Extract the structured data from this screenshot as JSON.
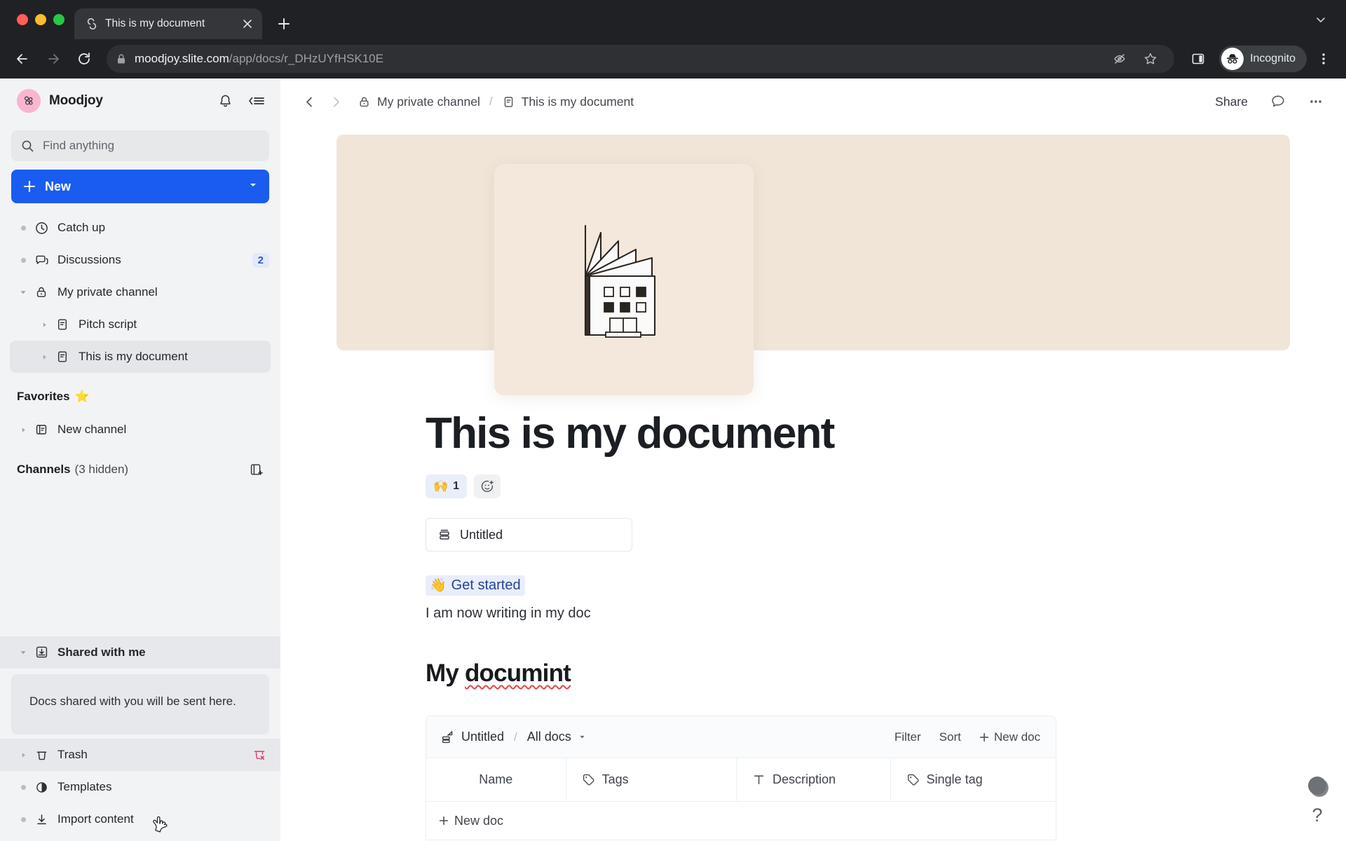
{
  "browser": {
    "tab": {
      "title": "This is my document",
      "favicon": "slite-favicon",
      "close_icon": "close-icon"
    },
    "new_tab_icon": "plus-icon",
    "tabstrip_menu_icon": "chevron-down-icon",
    "nav": {
      "back_icon": "back-arrow-icon",
      "forward_icon": "forward-arrow-icon",
      "reload_icon": "reload-icon"
    },
    "omnibox": {
      "lock_icon": "lock-icon",
      "host": "moodjoy.slite.com",
      "path": "/app/docs/r_DHzUYfHSK10E"
    },
    "actions": {
      "hidden_icon": "eye-off-icon",
      "bookmark_icon": "star-icon",
      "sidepanel_icon": "side-panel-icon",
      "menu_icon": "kebab-menu-icon"
    },
    "profile": {
      "label": "Incognito",
      "icon": "incognito-icon"
    }
  },
  "sidebar": {
    "workspace": {
      "name": "Moodjoy",
      "avatar_icon": "moodjoy-logo"
    },
    "header_actions": {
      "notifications_icon": "bell-icon",
      "collapse_icon": "collapse-sidebar-icon"
    },
    "search": {
      "placeholder": "Find anything",
      "icon": "search-icon"
    },
    "new_button": {
      "label": "New",
      "plus_icon": "plus-icon",
      "caret_icon": "chevron-down-icon"
    },
    "nav_items": [
      {
        "label": "Catch up",
        "icon": "clock-icon"
      },
      {
        "label": "Discussions",
        "icon": "chat-bubbles-icon",
        "badge": "2"
      }
    ],
    "channel": {
      "label": "My private channel",
      "icon": "lock-icon",
      "twisty": "caret-down-icon"
    },
    "channel_docs": [
      {
        "label": "Pitch script",
        "icon": "doc-icon",
        "twisty": "caret-right-icon",
        "active": false
      },
      {
        "label": "This is my document",
        "icon": "doc-icon",
        "twisty": "caret-right-icon",
        "active": true
      }
    ],
    "favorites": {
      "title": "Favorites",
      "emoji": "⭐"
    },
    "favorite_items": [
      {
        "label": "New channel",
        "icon": "channel-icon",
        "twisty": "caret-right-icon"
      }
    ],
    "channels_section": {
      "title": "Channels",
      "subtitle": "(3 hidden)",
      "action_icon": "new-channel-icon"
    },
    "shared": {
      "label": "Shared with me",
      "icon": "inbox-download-icon",
      "twisty": "caret-down-icon",
      "empty_text": "Docs shared with you will be sent here."
    },
    "bottom_items": [
      {
        "label": "Trash",
        "icon": "trash-icon",
        "twisty": "caret-right-icon",
        "action_icon": "empty-trash-icon",
        "hovered": true
      },
      {
        "label": "Templates",
        "icon": "templates-icon",
        "twisty": "bullet"
      },
      {
        "label": "Import content",
        "icon": "import-icon",
        "twisty": "bullet"
      }
    ]
  },
  "doc_toolbar": {
    "back_icon": "chevron-left-icon",
    "forward_icon": "chevron-right-icon",
    "breadcrumb": [
      {
        "label": "My private channel",
        "icon": "lock-icon"
      },
      {
        "label": "This is my document",
        "icon": "doc-icon"
      }
    ],
    "separator": "/",
    "share_label": "Share",
    "comment_icon": "comment-icon",
    "more_icon": "ellipsis-icon"
  },
  "document": {
    "banner": {
      "illustration": "factory-building-illustration",
      "banner_color": "#f1e5d8",
      "card_color": "#f4e8dc"
    },
    "title": "This is my document",
    "reactions": [
      {
        "emoji": "🙌",
        "count": "1"
      }
    ],
    "add_reaction_icon": "add-reaction-icon",
    "embed": {
      "label": "Untitled",
      "icon": "collection-icon"
    },
    "link_block": {
      "emoji": "👋",
      "text": "Get started",
      "color": "#22439a"
    },
    "paragraph": "I am now writing in my doc",
    "heading2": {
      "prefix": "My ",
      "misspelled": "documint"
    },
    "collection": {
      "header": {
        "icon": "collection-share-icon",
        "name": "Untitled",
        "separator": "/",
        "view": "All docs",
        "view_caret": "caret-down-icon"
      },
      "actions": {
        "filter": "Filter",
        "sort": "Sort",
        "new_doc": "New doc",
        "new_doc_icon": "plus-icon"
      },
      "columns": [
        {
          "label": "Name",
          "icon": null
        },
        {
          "label": "Tags",
          "icon": "tag-icon"
        },
        {
          "label": "Description",
          "icon": "text-icon"
        },
        {
          "label": "Single tag",
          "icon": "tag-icon"
        }
      ],
      "new_row": {
        "label": "New doc",
        "icon": "plus-icon"
      }
    }
  },
  "help_widget": {
    "badge_icon": "help-badge",
    "question_mark": "?"
  }
}
